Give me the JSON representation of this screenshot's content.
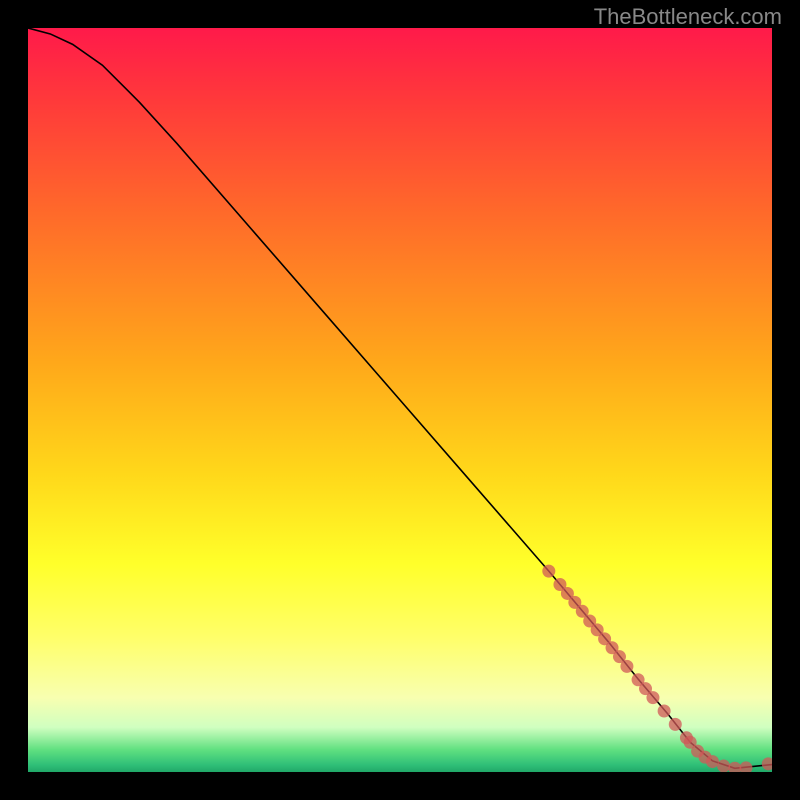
{
  "watermark": "TheBottleneck.com",
  "chart_data": {
    "type": "line",
    "title": "",
    "xlabel": "",
    "ylabel": "",
    "xlim": [
      0,
      100
    ],
    "ylim": [
      0,
      100
    ],
    "curve": {
      "x": [
        0,
        3,
        6,
        10,
        15,
        20,
        30,
        40,
        50,
        60,
        70,
        78,
        82,
        86,
        89,
        92,
        95,
        100
      ],
      "y": [
        100,
        99.2,
        97.8,
        95,
        90,
        84.5,
        73,
        61.5,
        50,
        38.5,
        27,
        17.5,
        12.5,
        7.8,
        4.0,
        1.5,
        0.5,
        1.0
      ]
    },
    "series": [
      {
        "name": "markers",
        "x": [
          70,
          71.5,
          72.5,
          73.5,
          74.5,
          75.5,
          76.5,
          77.5,
          78.5,
          79.5,
          80.5,
          82,
          83,
          84,
          85.5,
          87,
          88.5,
          89,
          90,
          91,
          92,
          93.5,
          95,
          96.5,
          99.5
        ],
        "y": [
          27,
          25.2,
          24,
          22.8,
          21.6,
          20.3,
          19.1,
          17.9,
          16.7,
          15.5,
          14.2,
          12.4,
          11.2,
          10,
          8.2,
          6.4,
          4.6,
          4.0,
          2.8,
          2.0,
          1.4,
          0.8,
          0.5,
          0.55,
          1.1
        ]
      }
    ],
    "background_gradient": {
      "top": "#ff1a4a",
      "mid_orange": "#ffa81a",
      "mid_yellow": "#ffff2a",
      "bottom": "#20a868"
    }
  }
}
